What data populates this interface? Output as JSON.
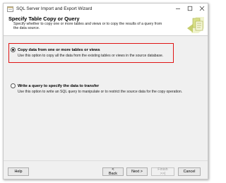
{
  "window": {
    "title": "SQL Server Import and Export Wizard"
  },
  "header": {
    "title": "Specify Table Copy or Query",
    "description": "Specify whether to copy one or more tables and views or to copy the results of a query from the data source."
  },
  "options": [
    {
      "label": "Copy data from one or more tables or views",
      "description": "Use this option to copy all the data from the existing tables or views in the source database.",
      "selected": true
    },
    {
      "label": "Write a query to specify the data to transfer",
      "description": "Use this option to write an SQL query to manipulate or to restrict the source data for the copy operation.",
      "selected": false
    }
  ],
  "buttons": {
    "help": "Help",
    "back": "< Back",
    "next": "Next >",
    "finish": "Finish >>|",
    "cancel": "Cancel"
  },
  "colors": {
    "highlight_border": "#e01515",
    "window_bg": "#f0f0f0",
    "header_bg": "#ffffff"
  }
}
